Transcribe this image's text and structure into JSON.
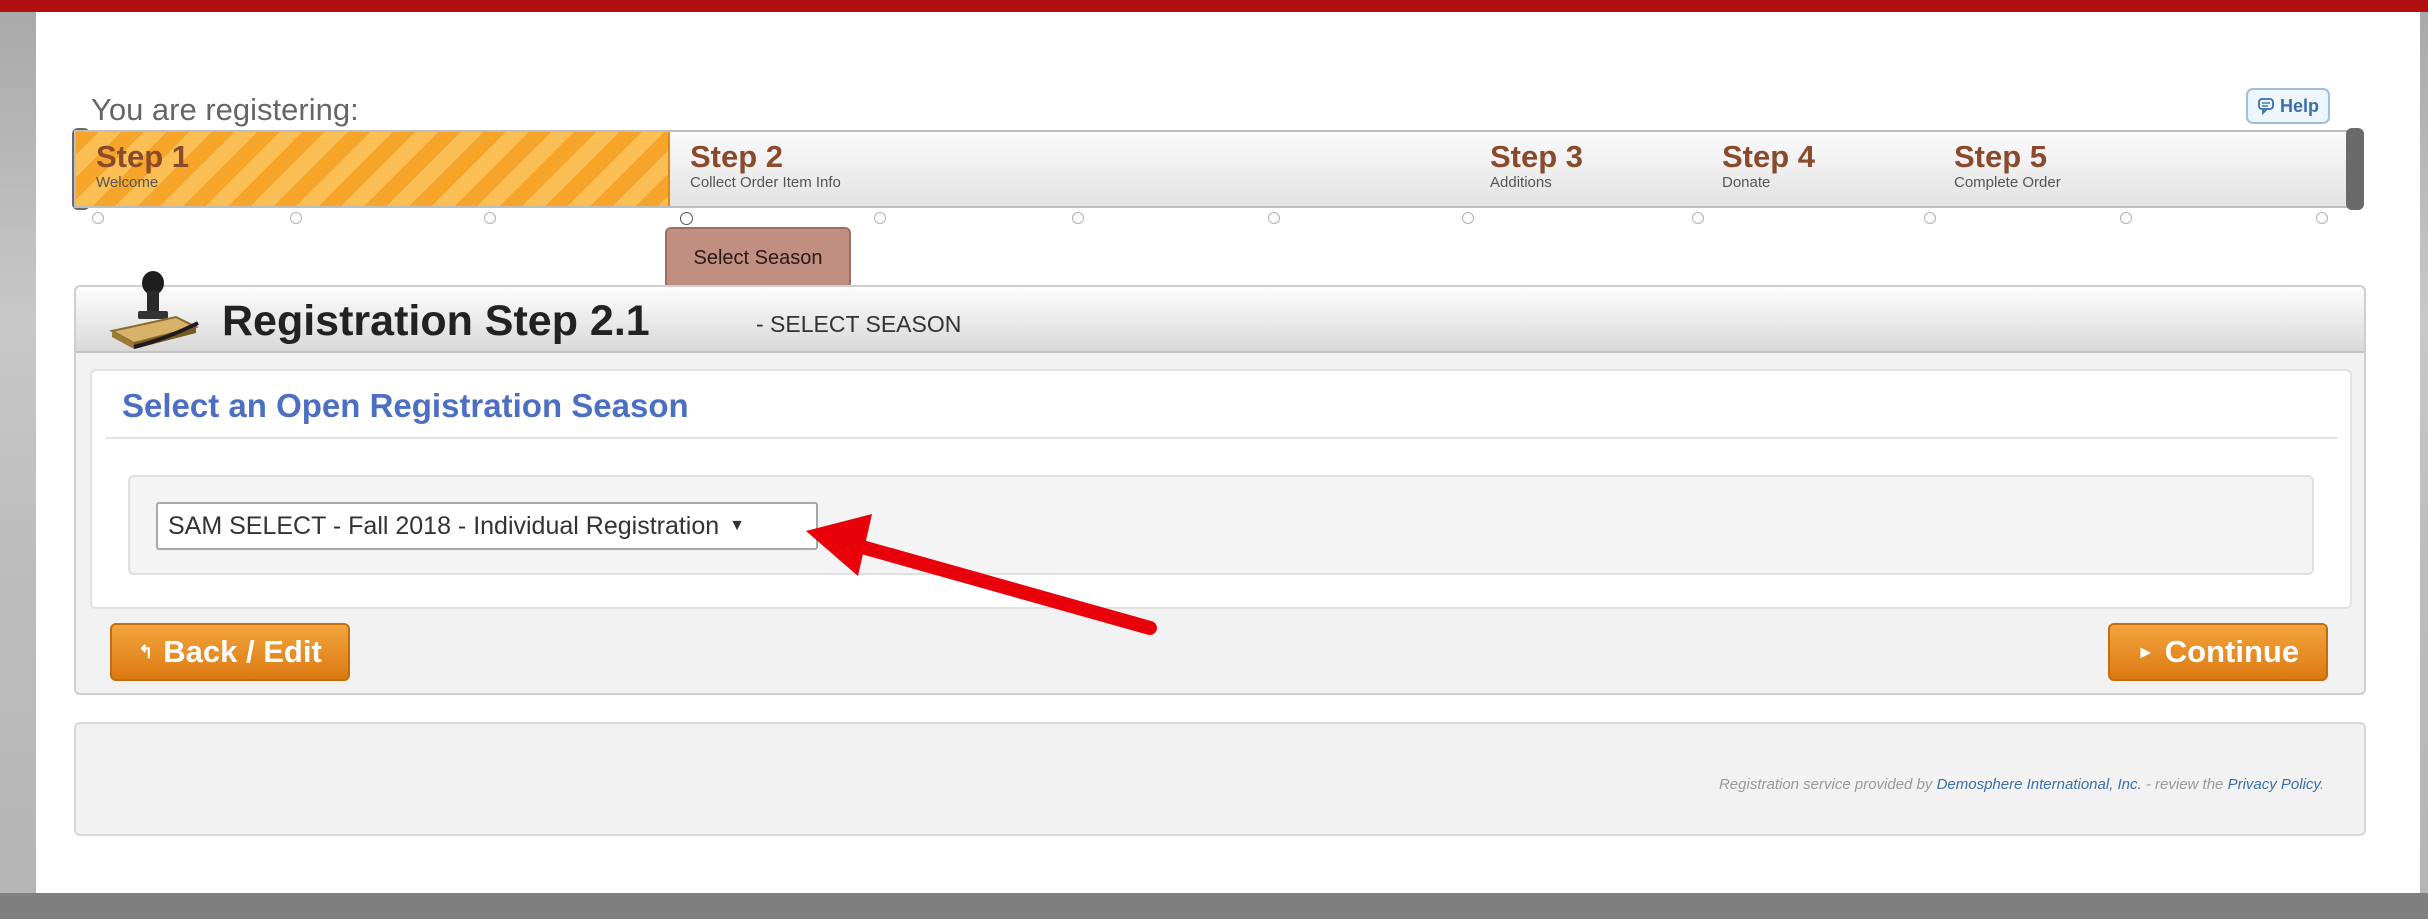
{
  "header": {
    "registering_label": "You are registering:",
    "help_label": "Help"
  },
  "steps": [
    {
      "title": "Step 1",
      "subtitle": "Welcome",
      "active": true
    },
    {
      "title": "Step 2",
      "subtitle": "Collect Order Item Info",
      "active": false
    },
    {
      "title": "Step 3",
      "subtitle": "Additions",
      "active": false
    },
    {
      "title": "Step 4",
      "subtitle": "Donate",
      "active": false
    },
    {
      "title": "Step 5",
      "subtitle": "Complete Order",
      "active": false
    }
  ],
  "current_substep_label": "Select Season",
  "panel": {
    "title": "Registration Step 2.1",
    "subtitle": "- SELECT SEASON",
    "section_title": "Select an Open Registration Season",
    "season_select": {
      "selected": "SAM SELECT - Fall 2018 - Individual Registration",
      "caret": "▼"
    },
    "back_button": "Back / Edit",
    "back_icon": "↰",
    "continue_button": "Continue",
    "continue_icon": "►"
  },
  "footer": {
    "prefix": "Registration service provided by ",
    "provider_link": "Demosphere International, Inc.",
    "middle": " - review the ",
    "privacy_link": "Privacy Policy",
    "suffix": "."
  },
  "colors": {
    "brand_red": "#b00f10",
    "accent_orange": "#dc7a13",
    "section_blue": "#4d6fc3",
    "annotation_arrow": "#e8000a"
  },
  "icons": [
    "help-icon",
    "stamp-icon",
    "back-icon",
    "continue-icon",
    "dropdown-caret-icon"
  ]
}
